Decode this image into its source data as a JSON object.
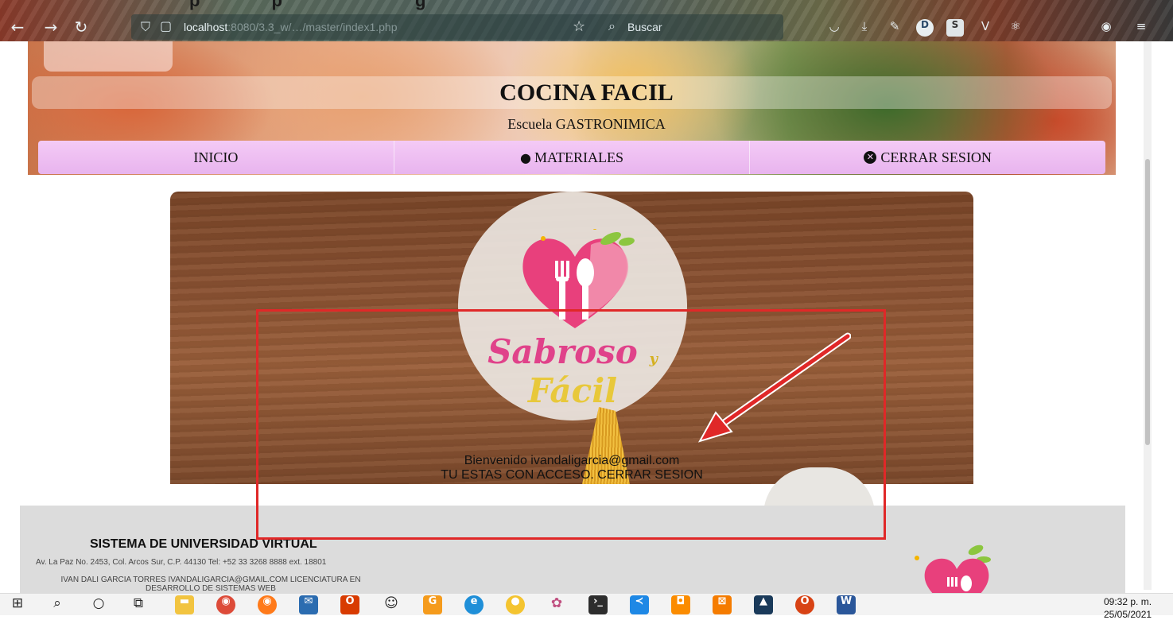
{
  "browser": {
    "clipped_title": "p",
    "url_host": "localhost",
    "url_path": ":8080/3.3_w/…/master/index1.php",
    "search_placeholder": "Buscar"
  },
  "site": {
    "title": "COCINA FACIL",
    "subtitle": "Escuela GASTRONIMICA"
  },
  "nav": {
    "items": [
      {
        "label": "INICIO",
        "icon": ""
      },
      {
        "label": "MATERIALES",
        "icon": "apple-icon"
      },
      {
        "label": "CERRAR SESION",
        "icon": "close-circle-icon"
      }
    ]
  },
  "hero": {
    "brand_word1": "Sabroso",
    "brand_y": "y",
    "brand_word2": "Fácil",
    "welcome": "Bienvenido  ivandaligarcia@gmail.com",
    "access": "TU ESTAS CON ACCESO. CERRAR SESION"
  },
  "footer": {
    "title": "SISTEMA DE UNIVERSIDAD VIRTUAL",
    "address": "Av. La Paz No. 2453, Col. Arcos Sur, C.P. 44130 Tel: +52 33 3268 8888 ext. 18801",
    "contact": "IVAN DALI GARCIA TORRES IVANDALIGARCIA@GMAIL.COM LICENCIATURA EN DESARROLLO DE SISTEMAS WEB"
  },
  "taskbar": {
    "time": "09:32 p. m.",
    "date": "25/05/2021"
  },
  "colors": {
    "nav_bg": "#f0c2f4",
    "annotation": "#e02828",
    "brand_pink": "#e0428a"
  }
}
